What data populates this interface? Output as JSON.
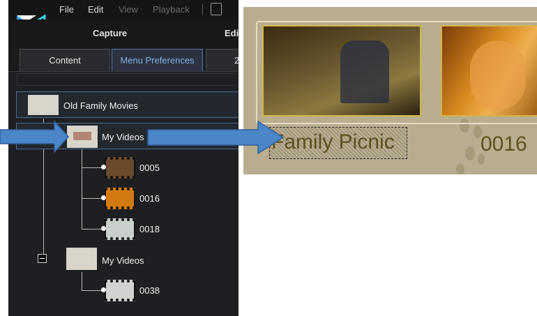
{
  "menu": {
    "file": "File",
    "edit": "Edit",
    "view": "View",
    "playback": "Playback"
  },
  "modes": {
    "capture": "Capture",
    "edit": "Edi"
  },
  "tabs": {
    "content": "Content",
    "menu_preferences": "Menu Preferences",
    "third": "2"
  },
  "tree": {
    "root": {
      "label": "Old Family Movies"
    },
    "folder1": {
      "label": "My Videos",
      "children": [
        {
          "label": "0005"
        },
        {
          "label": "0016"
        },
        {
          "label": "0018"
        }
      ]
    },
    "folder2": {
      "label": "My Videos",
      "children": [
        {
          "label": "0038"
        }
      ]
    }
  },
  "preview": {
    "title_label": "Family Picnic",
    "next_label": "0016"
  },
  "colors": {
    "accent_tab": "#7fb0e8",
    "selection_border": "#4b6d96",
    "arrow": "#4a86c8",
    "caption": "#5e5020"
  }
}
